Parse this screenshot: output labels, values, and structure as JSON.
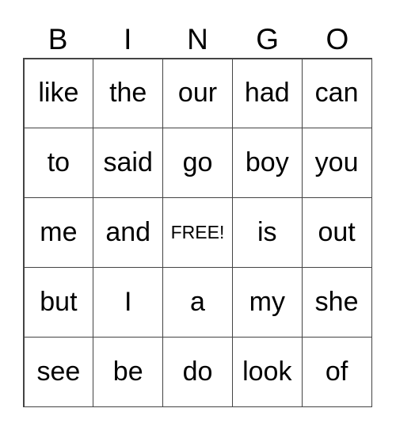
{
  "header": [
    "B",
    "I",
    "N",
    "G",
    "O"
  ],
  "cells": [
    [
      "like",
      "the",
      "our",
      "had",
      "can"
    ],
    [
      "to",
      "said",
      "go",
      "boy",
      "you"
    ],
    [
      "me",
      "and",
      "FREE!",
      "is",
      "out"
    ],
    [
      "but",
      "I",
      "a",
      "my",
      "she"
    ],
    [
      "see",
      "be",
      "do",
      "look",
      "of"
    ]
  ]
}
